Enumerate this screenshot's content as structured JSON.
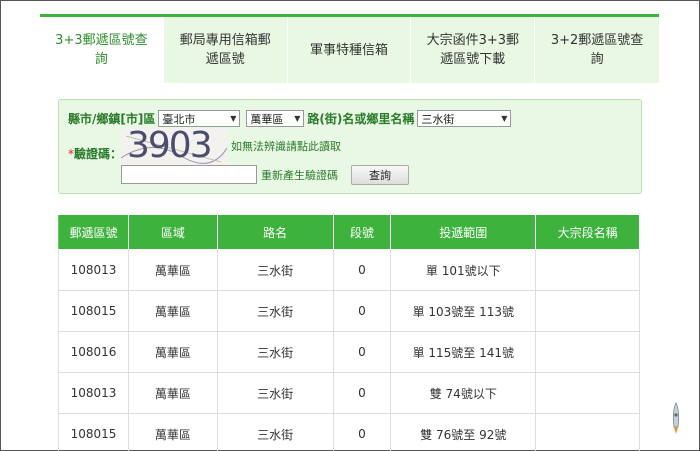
{
  "tabs": [
    {
      "label": "3+3郵遞區號查詢",
      "active": true
    },
    {
      "label": "郵局專用信箱郵遞區號",
      "active": false
    },
    {
      "label": "軍事特種信箱",
      "active": false
    },
    {
      "label": "大宗函件3+3郵遞區號下載",
      "active": false
    },
    {
      "label": "3+2郵遞區號查詢",
      "active": false
    }
  ],
  "form": {
    "city_label": "縣市/鄉鎮[市]區",
    "city_value": "臺北市",
    "district_value": "萬華區",
    "road_label": "路(街)名或鄉里名稱",
    "road_value": "三水街",
    "captcha_label": "驗證碼：",
    "captcha_required_mark": "*",
    "captcha_text": "3903",
    "captcha_help": "如無法辨識請點此讀取",
    "regen_label": "重新產生驗證碼",
    "query_label": "查詢"
  },
  "table": {
    "headers": [
      "郵遞區號",
      "區域",
      "路名",
      "段號",
      "投遞範圍",
      "大宗段名稱"
    ],
    "rows": [
      [
        "108013",
        "萬華區",
        "三水街",
        "0",
        "單 101號以下",
        ""
      ],
      [
        "108015",
        "萬華區",
        "三水街",
        "0",
        "單 103號至 113號",
        ""
      ],
      [
        "108016",
        "萬華區",
        "三水街",
        "0",
        "單 115號至 141號",
        ""
      ],
      [
        "108013",
        "萬華區",
        "三水街",
        "0",
        "雙 74號以下",
        ""
      ],
      [
        "108015",
        "萬華區",
        "三水街",
        "0",
        "雙 76號至 92號",
        ""
      ]
    ]
  },
  "colors": {
    "accent": "#3db33d",
    "panel_bg": "#e9f8e4",
    "tab_bg": "#e8f8e3"
  }
}
